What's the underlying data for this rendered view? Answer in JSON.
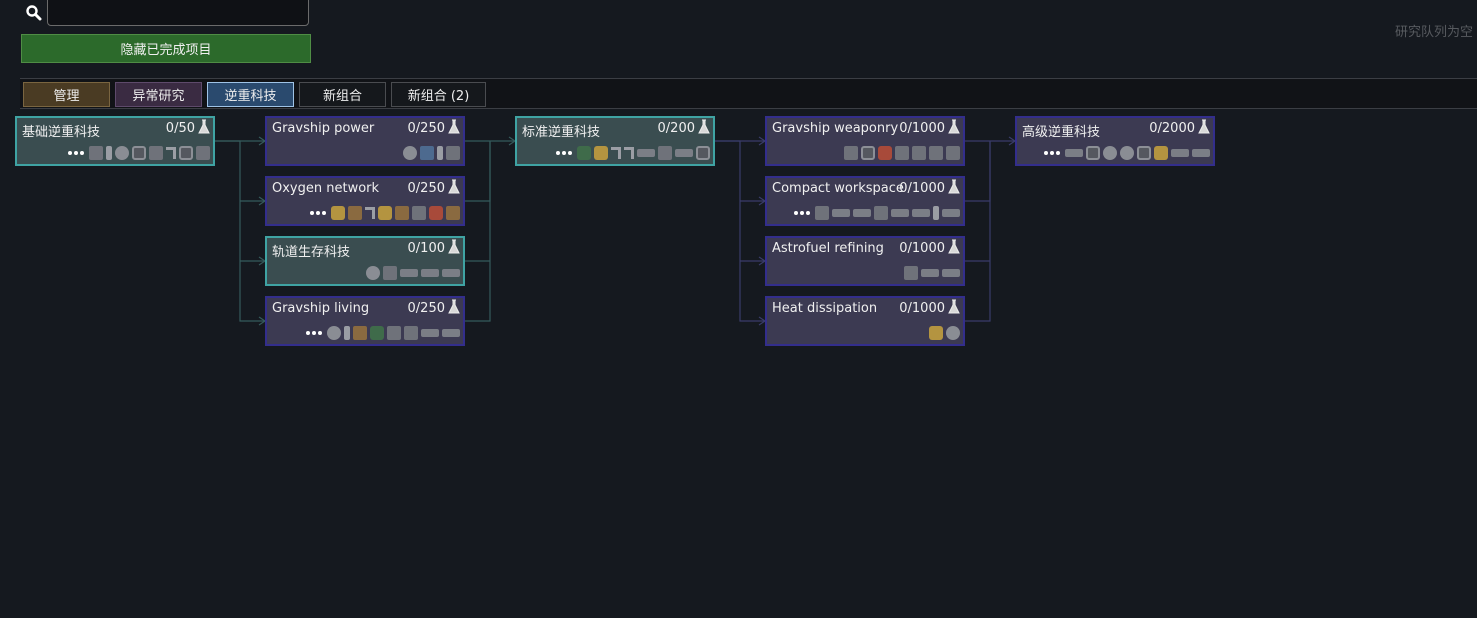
{
  "search": {
    "placeholder": "",
    "value": ""
  },
  "hide_completed_label": "隐藏已完成项目",
  "queue_empty_label": "研究队列为空",
  "tabs": [
    "管理",
    "异常研究",
    "逆重科技",
    "新组合",
    "新组合 (2)"
  ],
  "active_tab": "逆重科技",
  "nodes": [
    {
      "name": "基础逆重科技",
      "cost": "0/50",
      "completed": true,
      "more": true,
      "icons": [
        "sq",
        "tl",
        "rnd",
        "gear",
        "sq",
        "hk",
        "gear",
        "sq"
      ]
    },
    {
      "name": "Gravship power",
      "cost": "0/250",
      "completed": false,
      "more": false,
      "icons": [
        "rnd",
        "blu",
        "tl",
        "sq"
      ]
    },
    {
      "name": "Oxygen network",
      "cost": "0/250",
      "completed": false,
      "more": true,
      "icons": [
        "gld",
        "brn",
        "hk",
        "gld",
        "brn",
        "sq",
        "red",
        "brn"
      ]
    },
    {
      "name": "轨道生存科技",
      "cost": "0/100",
      "completed": true,
      "more": false,
      "icons": [
        "rnd",
        "sq",
        "wd",
        "wd",
        "wd"
      ]
    },
    {
      "name": "Gravship living",
      "cost": "0/250",
      "completed": false,
      "more": true,
      "icons": [
        "rnd",
        "tl",
        "brn",
        "grn",
        "sq",
        "sq",
        "wd",
        "wd"
      ]
    },
    {
      "name": "标准逆重科技",
      "cost": "0/200",
      "completed": true,
      "more": true,
      "icons": [
        "grn",
        "gld",
        "hk",
        "hk",
        "wd",
        "sq",
        "wd",
        "gear"
      ]
    },
    {
      "name": "Gravship weaponry",
      "cost": "0/1000",
      "completed": false,
      "more": false,
      "icons": [
        "sq",
        "gear",
        "red",
        "sq",
        "sq",
        "sq",
        "sq"
      ]
    },
    {
      "name": "Compact workspace",
      "cost": "0/1000",
      "completed": false,
      "more": true,
      "icons": [
        "sq",
        "wd",
        "wd",
        "sq",
        "wd",
        "wd",
        "tl",
        "wd"
      ]
    },
    {
      "name": "Astrofuel refining",
      "cost": "0/1000",
      "completed": false,
      "more": false,
      "icons": [
        "sq",
        "wd",
        "wd"
      ]
    },
    {
      "name": "Heat dissipation",
      "cost": "0/1000",
      "completed": false,
      "more": false,
      "icons": [
        "gld",
        "rnd"
      ]
    },
    {
      "name": "高级逆重科技",
      "cost": "0/2000",
      "completed": false,
      "more": true,
      "icons": [
        "wd",
        "gear",
        "rnd",
        "rnd",
        "gear",
        "gld",
        "wd",
        "wd"
      ]
    }
  ]
}
